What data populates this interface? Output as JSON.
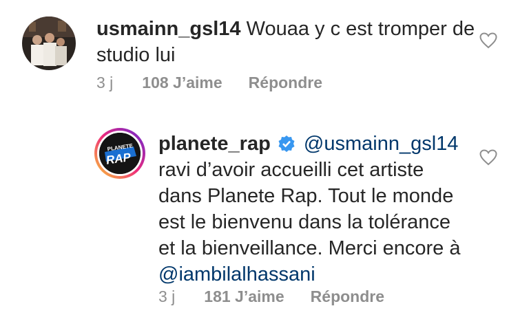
{
  "comment": {
    "username": "usmainn_gsl14",
    "text": "Wouaa  y c est tromper de studio lui",
    "time": "3 j",
    "likes": "108 J’aime",
    "reply": "Répondre"
  },
  "reply": {
    "username": "planete_rap",
    "verified": true,
    "mention": "@usmainn_gsl14",
    "text": "ravi d’avoir accueilli cet artiste dans Planete Rap. Tout le monde est le bienvenu dans la tolérance et la bienveillance. Merci encore à",
    "mention_end": "@iambilalhassani",
    "avatar_logo_text": "PLANETE RAP",
    "time": "3 j",
    "likes": "181 J’aime",
    "reply": "Répondre"
  },
  "colors": {
    "text": "#262626",
    "meta": "#8e8e8e",
    "mention": "#00376b",
    "verified": "#3897f0"
  }
}
